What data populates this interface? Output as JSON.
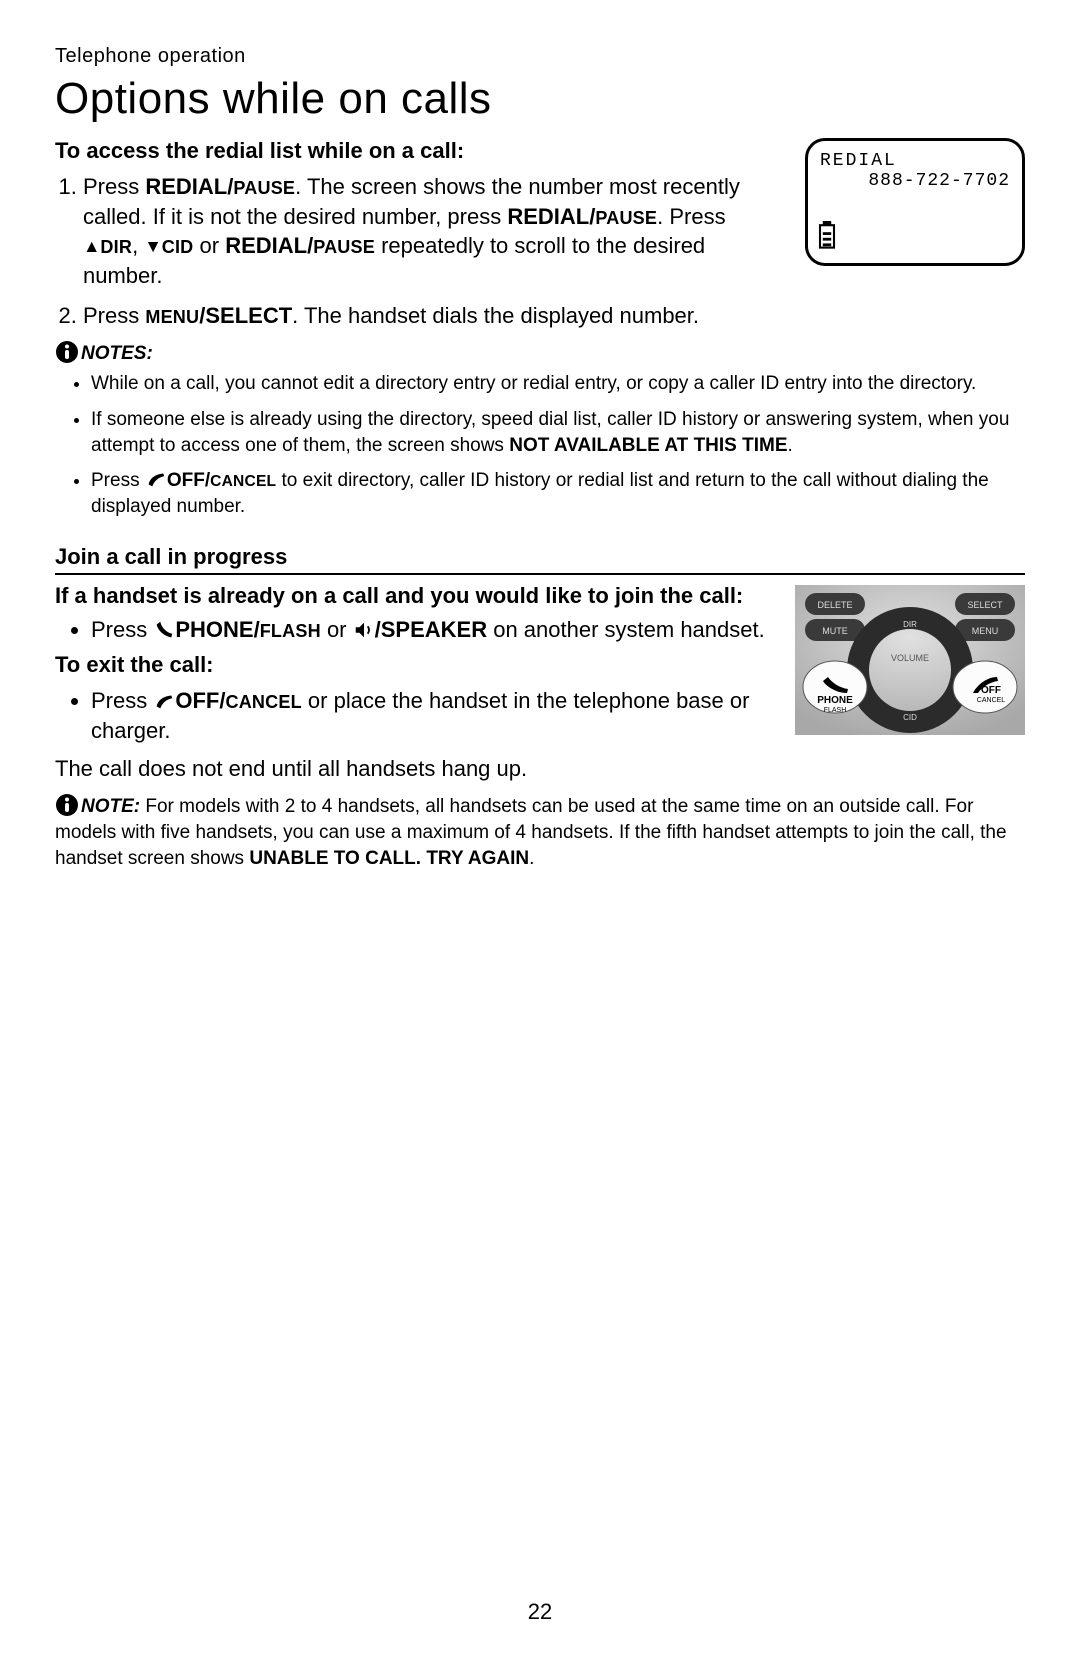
{
  "header": {
    "crumb": "Telephone operation"
  },
  "title": "Options while on calls",
  "redial": {
    "heading": "To access the redial list while on a call:",
    "step1_a": "Press ",
    "step1_btn1": "REDIAL/",
    "step1_btn1b_small": "PAUSE",
    "step1_b": ". The screen shows the number most recently called. If it is not the desired number, press ",
    "step1_btn2": "REDIAL/",
    "step1_btn2b_small": "PAUSE",
    "step1_c": ". Press ",
    "step1_dir_small": "DIR",
    "step1_comma": ", ",
    "step1_cid_small": "CID",
    "step1_or": " or ",
    "step1_btn3": "REDIAL/",
    "step1_btn3b_small": "PAUSE",
    "step1_d": " repeatedly to scroll to the desired number.",
    "step2_a": "Press ",
    "step2_menu_small": "MENU",
    "step2_select": "/SELECT",
    "step2_b": ". The handset dials the displayed number."
  },
  "lcd": {
    "line1": "REDIAL",
    "line2": "888-722-7702"
  },
  "notes_head": "NOTES:",
  "notes": {
    "n1": "While on a call, you cannot edit a directory entry or redial entry, or copy a caller ID entry into the directory.",
    "n2a": "If someone else is already using the directory, speed dial list, caller ID history or answering system, when you attempt to access one of them, the screen shows ",
    "n2b_bold": "NOT AVAILABLE AT THIS TIME",
    "n2c": ".",
    "n3a": "Press ",
    "n3b_bold": "OFF/",
    "n3b_small": "CANCEL",
    "n3c": " to exit directory, caller ID history or redial list and return to the call without dialing the displayed number."
  },
  "join": {
    "heading": "Join a call in progress",
    "intro_bold": "If a handset is already on a call and you would like to join the call:",
    "press": "Press ",
    "phone_bold": "PHONE/",
    "flash_small": "FLASH",
    "or": " or ",
    "speaker_bold": "/SPEAKER",
    "tail": " on another system handset.",
    "exit_head": "To exit the call:",
    "exit_press": "Press ",
    "exit_off": "OFF/",
    "exit_cancel_small": "CANCEL",
    "exit_tail": " or place the handset in the telephone base or charger.",
    "allhang": "The call does not end until all handsets hang up."
  },
  "keypad": {
    "delete": "DELETE",
    "select": "SELECT",
    "mute": "MUTE",
    "dir": "DIR",
    "menu": "MENU",
    "volume": "VOLUME",
    "phone": "PHONE",
    "flash": "FLASH",
    "cid": "CID",
    "off": "OFF",
    "cancel": "CANCEL"
  },
  "note_final": {
    "lead": "NOTE:",
    "a": " For models with 2 to 4 handsets, all handsets can be used at the same time on an outside call. For models with five handsets, you can use a maximum of 4 handsets. If the fifth handset attempts to join the call, the handset screen shows ",
    "b_bold": "UNABLE TO CALL. TRY AGAIN",
    "c": "."
  },
  "page_number": "22"
}
